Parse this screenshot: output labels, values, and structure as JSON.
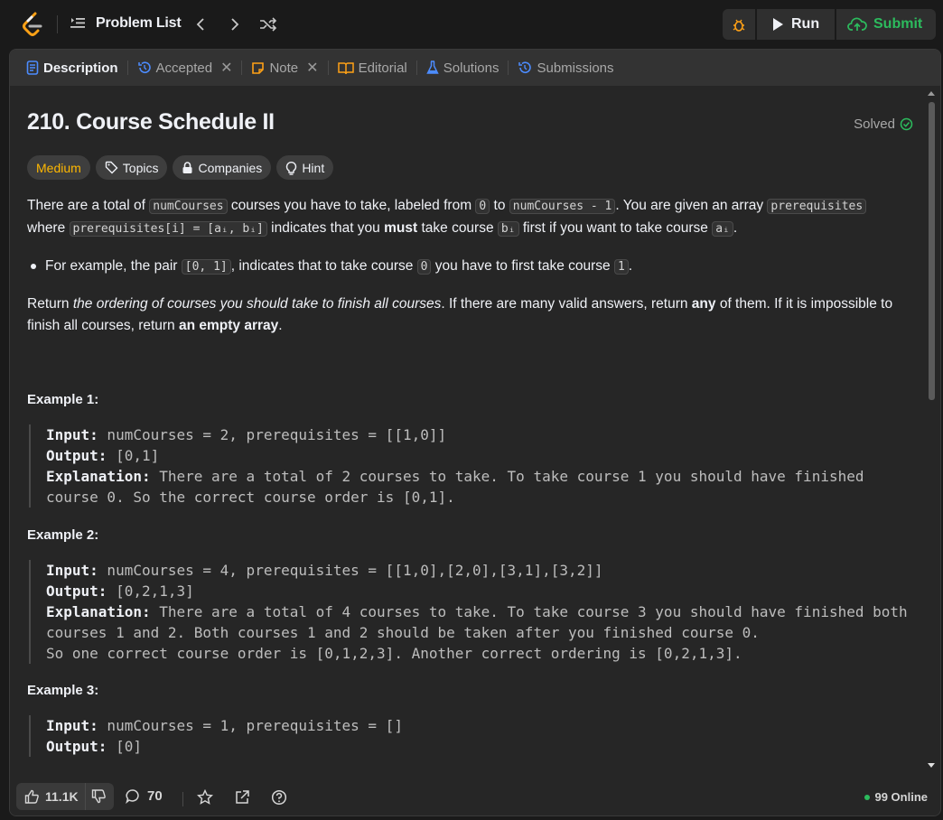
{
  "nav": {
    "problem_list": "Problem List",
    "run": "Run",
    "submit": "Submit"
  },
  "tabs": [
    {
      "label": "Description",
      "icon": "description-icon"
    },
    {
      "label": "Accepted",
      "icon": "history-icon"
    },
    {
      "label": "Note",
      "icon": "note-icon"
    },
    {
      "label": "Editorial",
      "icon": "book-icon"
    },
    {
      "label": "Solutions",
      "icon": "flask-icon"
    },
    {
      "label": "Submissions",
      "icon": "history-icon"
    }
  ],
  "problem": {
    "title": "210. Course Schedule II",
    "solved": "Solved",
    "difficulty": "Medium",
    "topics": "Topics",
    "companies": "Companies",
    "hint": "Hint"
  },
  "description": {
    "p1": {
      "t1": "There are a total of ",
      "c1": "numCourses",
      "t2": " courses you have to take, labeled from ",
      "c2": "0",
      "t3": " to ",
      "c3": "numCourses - 1",
      "t4": ". You are given an array ",
      "c4": "prerequisites",
      "t5": " where ",
      "c5": "prerequisites[i] = [aᵢ, bᵢ]",
      "t6": " indicates that you ",
      "b1": "must",
      "t7": " take course ",
      "c6": "bᵢ",
      "t8": " first if you want to take course ",
      "c7": "aᵢ",
      "t9": "."
    },
    "bullet": {
      "t1": "For example, the pair ",
      "c1": "[0, 1]",
      "t2": ", indicates that to take course ",
      "c2": "0",
      "t3": " you have to first take course ",
      "c3": "1",
      "t4": "."
    },
    "p2": {
      "t1": "Return ",
      "i1": "the ordering of courses you should take to finish all courses",
      "t2": ". If there are many valid answers, return ",
      "b1": "any",
      "t3": " of them. If it is impossible to finish all courses, return ",
      "b2": "an empty array",
      "t4": "."
    }
  },
  "examples": [
    {
      "title": "Example 1:",
      "input_label": "Input:",
      "input": " numCourses = 2, prerequisites = [[1,0]]",
      "output_label": "Output:",
      "output": " [0,1]",
      "explanation_label": "Explanation:",
      "explanation": " There are a total of 2 courses to take. To take course 1 you should have finished course 0. So the correct course order is [0,1]."
    },
    {
      "title": "Example 2:",
      "input_label": "Input:",
      "input": " numCourses = 4, prerequisites = [[1,0],[2,0],[3,1],[3,2]]",
      "output_label": "Output:",
      "output": " [0,2,1,3]",
      "explanation_label": "Explanation:",
      "explanation": " There are a total of 4 courses to take. To take course 3 you should have finished both courses 1 and 2. Both courses 1 and 2 should be taken after you finished course 0.",
      "explanation2": "So one correct course order is [0,1,2,3]. Another correct ordering is [0,2,1,3]."
    },
    {
      "title": "Example 3:",
      "input_label": "Input:",
      "input": " numCourses = 1, prerequisites = []",
      "output_label": "Output:",
      "output": " [0]"
    }
  ],
  "footer": {
    "likes": "11.1K",
    "comments": "70",
    "online": "99 Online"
  },
  "colors": {
    "accent_green": "#2cbb5d",
    "medium": "#ffb800",
    "tab_blue": "#4c8cff"
  }
}
